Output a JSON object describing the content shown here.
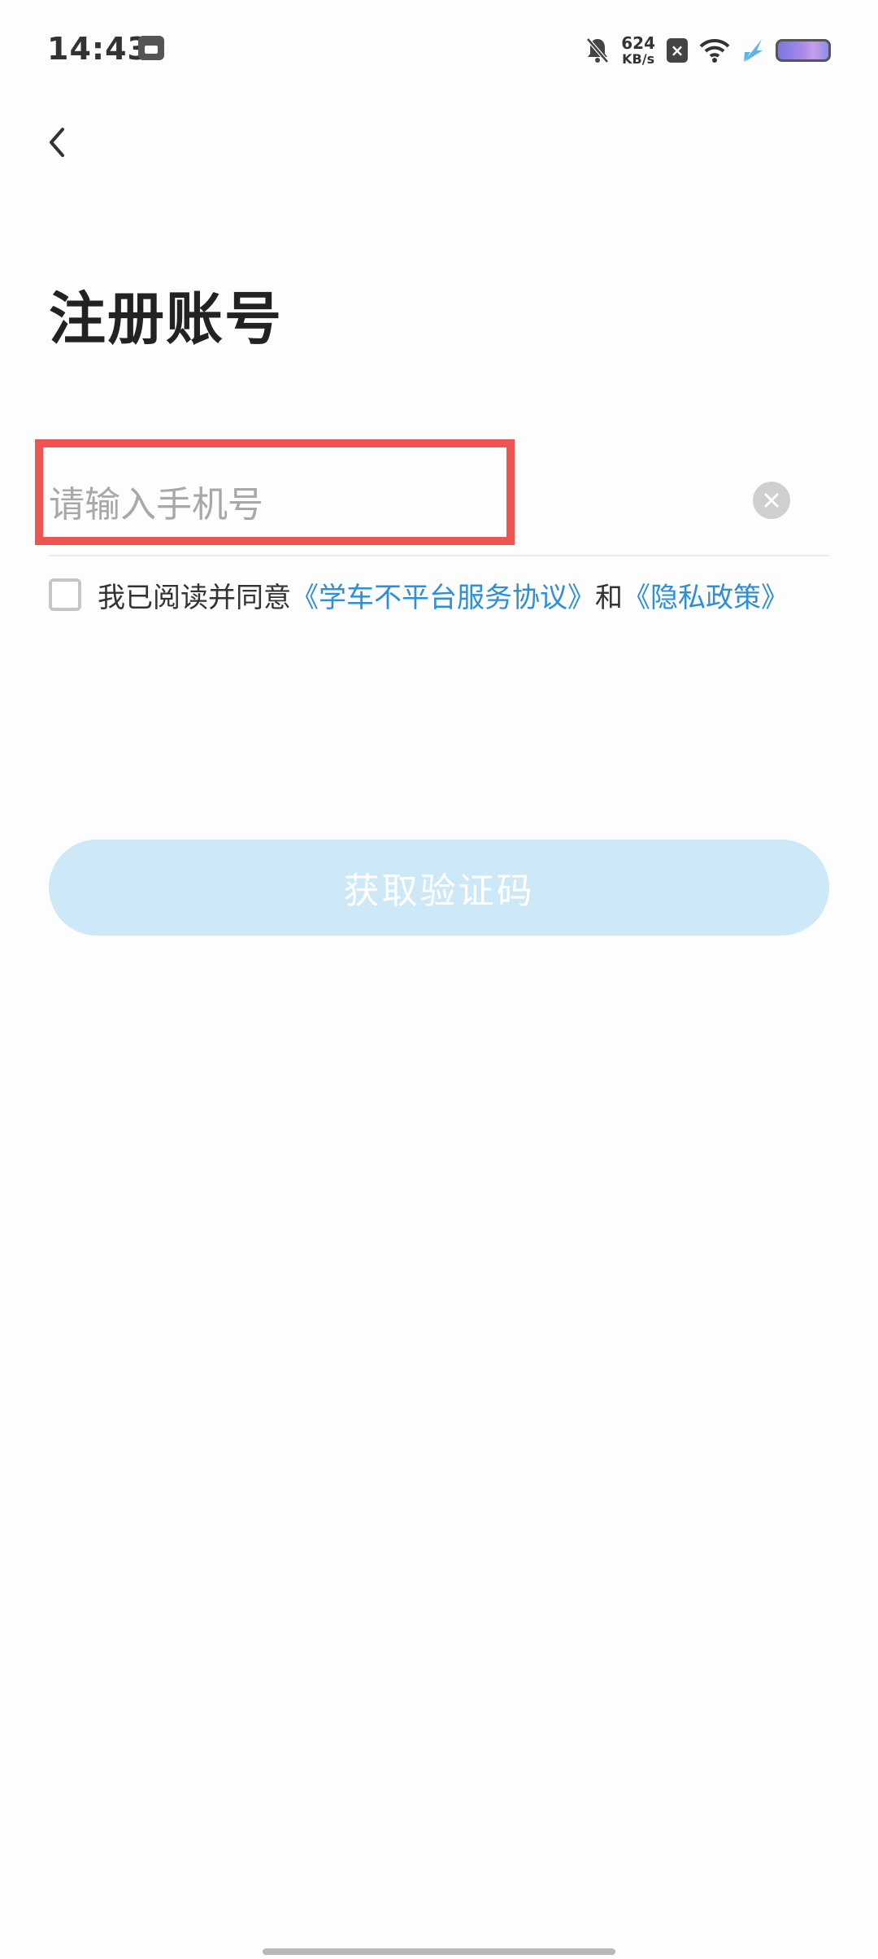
{
  "status_bar": {
    "time": "14:43",
    "net_speed_value": "624",
    "net_speed_unit": "KB/s",
    "icons": [
      "calendar-app-icon",
      "mute-icon",
      "x-icon",
      "wifi-icon",
      "bolt-icon",
      "battery-icon"
    ]
  },
  "header": {
    "back_icon": "chevron-left-icon"
  },
  "page": {
    "title": "注册账号"
  },
  "form": {
    "phone_placeholder": "请输入手机号",
    "phone_value": "",
    "clear_icon": "clear-circle-icon"
  },
  "agreement": {
    "checked": false,
    "prefix": "我已阅读并同意",
    "service_link": "《学车不平台服务协议》",
    "conjunction": "和",
    "privacy_link": "《隐私政策》"
  },
  "actions": {
    "get_code_label": "获取验证码"
  },
  "colors": {
    "link": "#2d8fd8",
    "button_bg": "#cde9f7",
    "highlight": "#ee5450"
  }
}
